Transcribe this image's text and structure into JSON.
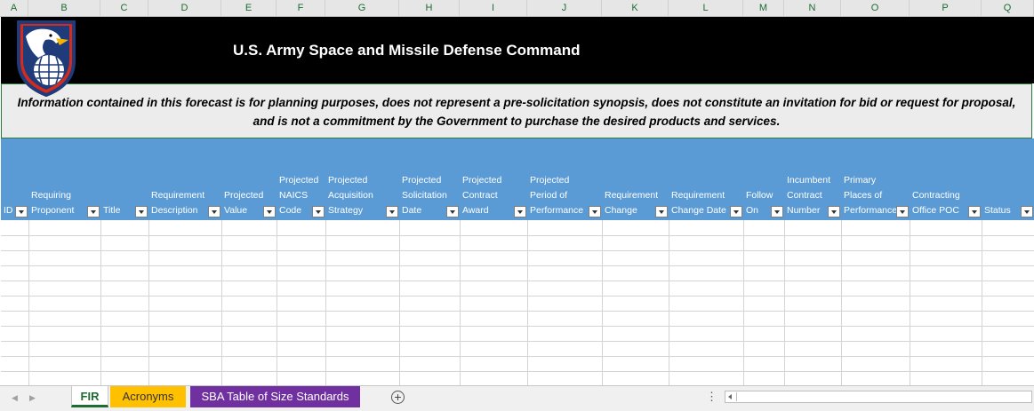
{
  "column_letters": [
    "A",
    "B",
    "C",
    "D",
    "E",
    "F",
    "G",
    "H",
    "I",
    "J",
    "K",
    "L",
    "M",
    "N",
    "O",
    "P",
    "Q"
  ],
  "banner": {
    "title": "U.S. Army Space and Missile Defense Command"
  },
  "disclaimer": {
    "line1": "Information contained in this forecast is for planning purposes, does not represent a pre-solicitation synopsis, does not constitute an invitation for bid or request for proposal,",
    "line2": "and is not a commitment by the Government to purchase the desired products and services."
  },
  "table_headers": [
    "ID",
    "Requiring\nProponent",
    "Title",
    "Requirement\nDescription",
    "Projected\nValue",
    "Projected\nNAICS\nCode",
    "Projected\nAcquisition\nStrategy",
    "Projected\nSolicitation\nDate",
    "Projected\nContract\nAward",
    "Projected\nPeriod of\nPerformance",
    "Requirement\nChange",
    "Requirement\nChange Date",
    "Follow\nOn",
    "Incumbent\nContract\nNumber",
    "Primary\nPlaces of\nPerformance",
    "Contracting\nOffice POC",
    "Status"
  ],
  "sheet_tabs": {
    "fir": "FIR",
    "acronyms": "Acronyms",
    "sba": "SBA Table of Size Standards",
    "add_symbol": "+"
  },
  "colors": {
    "header_blue": "#5b9bd5",
    "banner_black": "#000000",
    "tab_acronyms": "#ffc000",
    "tab_sba": "#7030a0",
    "excel_green": "#1e6b33"
  },
  "icons": [
    "eagle-logo-icon",
    "filter-dropdown-icon",
    "add-sheet-icon",
    "scroll-left-icon"
  ]
}
